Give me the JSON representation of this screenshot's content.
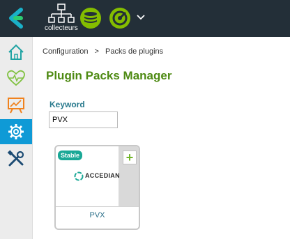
{
  "topbar": {
    "collectors_label": "collecteurs"
  },
  "sidebar": {
    "items": [
      {
        "name": "home"
      },
      {
        "name": "monitoring"
      },
      {
        "name": "reporting"
      },
      {
        "name": "configuration",
        "active": true
      },
      {
        "name": "administration"
      }
    ]
  },
  "breadcrumb": {
    "part1": "Configuration",
    "separator": ">",
    "part2": "Packs de plugins"
  },
  "page": {
    "title": "Plugin Packs Manager"
  },
  "filter": {
    "keyword_label": "Keyword",
    "keyword_value": "PVX"
  },
  "pack": {
    "status": "Stable",
    "add_symbol": "+",
    "vendor": "ACCEDIAN",
    "name": "PVX"
  },
  "colors": {
    "accent": "#0f9ad6",
    "title": "#4e8a13",
    "badge": "#1aa896"
  }
}
